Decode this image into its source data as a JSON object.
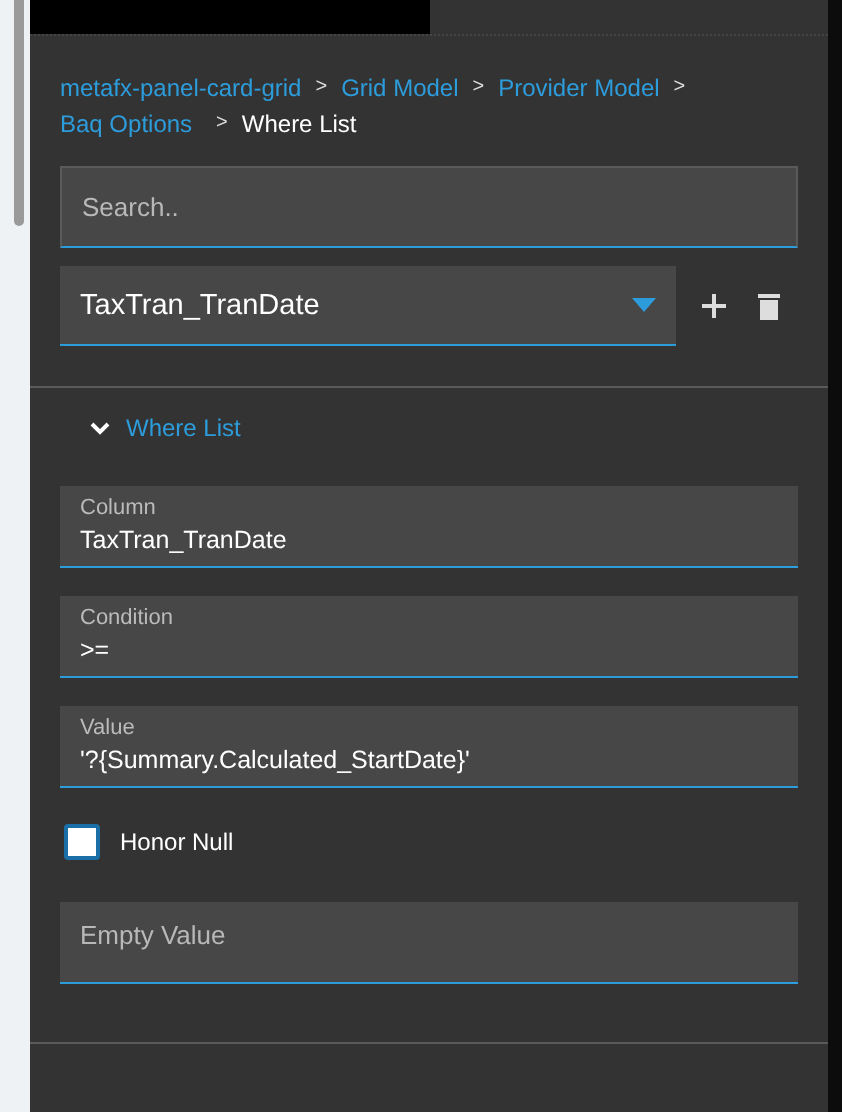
{
  "tabs": [
    {
      "selected": true
    },
    {
      "selected": false
    }
  ],
  "breadcrumb": {
    "links": [
      "metafx-panel-card-grid",
      "Grid Model",
      "Provider Model",
      "Baq Options"
    ],
    "separators": [
      ">",
      ">",
      ">",
      ">"
    ],
    "current": "Where List"
  },
  "search": {
    "placeholder": "Search.."
  },
  "selector": {
    "value": "TaxTran_TranDate"
  },
  "section": {
    "title": "Where List",
    "expanded": true
  },
  "fields": [
    {
      "label": "Column",
      "value": "TaxTran_TranDate"
    },
    {
      "label": "Condition",
      "value": ">="
    },
    {
      "label": "Value",
      "value": "'?{Summary.Calculated_StartDate}'"
    }
  ],
  "honor_null": {
    "label": "Honor Null",
    "checked": false
  },
  "empty_value": {
    "placeholder": "Empty Value"
  }
}
